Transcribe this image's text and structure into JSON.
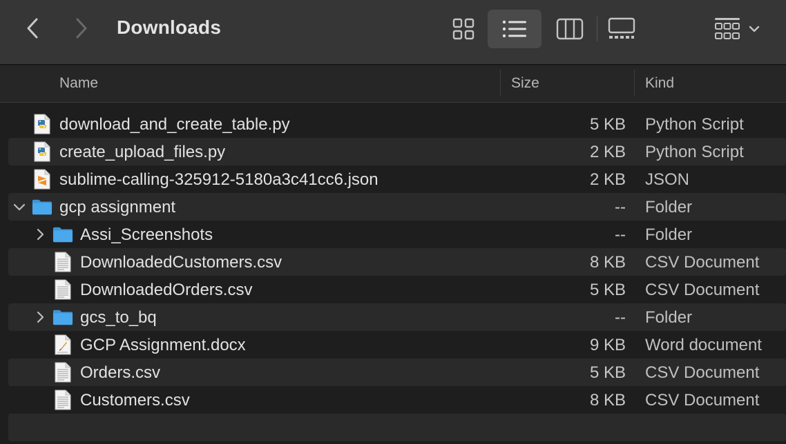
{
  "window": {
    "title": "Downloads"
  },
  "toolbar": {
    "back_icon": "chevron-left-icon",
    "forward_icon": "chevron-right-icon",
    "view_modes": [
      "icon-view",
      "list-view",
      "column-view",
      "gallery-view"
    ],
    "active_view": "list-view",
    "group_icon": "group-by-icon"
  },
  "columns": {
    "name": "Name",
    "size": "Size",
    "kind": "Kind"
  },
  "rows": [
    {
      "name": "download_and_create_table.py",
      "size": "5 KB",
      "kind": "Python Script",
      "icon": "python-file-icon",
      "depth": 0
    },
    {
      "name": "create_upload_files.py",
      "size": "2 KB",
      "kind": "Python Script",
      "icon": "python-file-icon",
      "depth": 0
    },
    {
      "name": "sublime-calling-325912-5180a3c41cc6.json",
      "size": "2 KB",
      "kind": "JSON",
      "icon": "sublime-file-icon",
      "depth": 0
    },
    {
      "name": "gcp assignment",
      "size": "--",
      "kind": "Folder",
      "icon": "folder-icon",
      "depth": 0,
      "disclosure": "expanded"
    },
    {
      "name": "Assi_Screenshots",
      "size": "--",
      "kind": "Folder",
      "icon": "folder-icon",
      "depth": 1,
      "disclosure": "collapsed"
    },
    {
      "name": "DownloadedCustomers.csv",
      "size": "8 KB",
      "kind": "CSV Document",
      "icon": "csv-file-icon",
      "depth": 1
    },
    {
      "name": "DownloadedOrders.csv",
      "size": "5 KB",
      "kind": "CSV Document",
      "icon": "csv-file-icon",
      "depth": 1
    },
    {
      "name": "gcs_to_bq",
      "size": "--",
      "kind": "Folder",
      "icon": "folder-icon",
      "depth": 1,
      "disclosure": "collapsed"
    },
    {
      "name": "GCP Assignment.docx",
      "size": "9 KB",
      "kind": "Word document",
      "icon": "word-file-icon",
      "depth": 1
    },
    {
      "name": "Orders.csv",
      "size": "5 KB",
      "kind": "CSV Document",
      "icon": "csv-file-icon",
      "depth": 1
    },
    {
      "name": "Customers.csv",
      "size": "8 KB",
      "kind": "CSV Document",
      "icon": "csv-file-icon",
      "depth": 1
    }
  ],
  "colors": {
    "toolbar_bg": "#363636",
    "window_bg": "#1e1e1e",
    "alt_row_bg": "#2a2a2a",
    "folder_blue": "#4aa8ec",
    "active_view_bg": "#4a4a4a"
  }
}
